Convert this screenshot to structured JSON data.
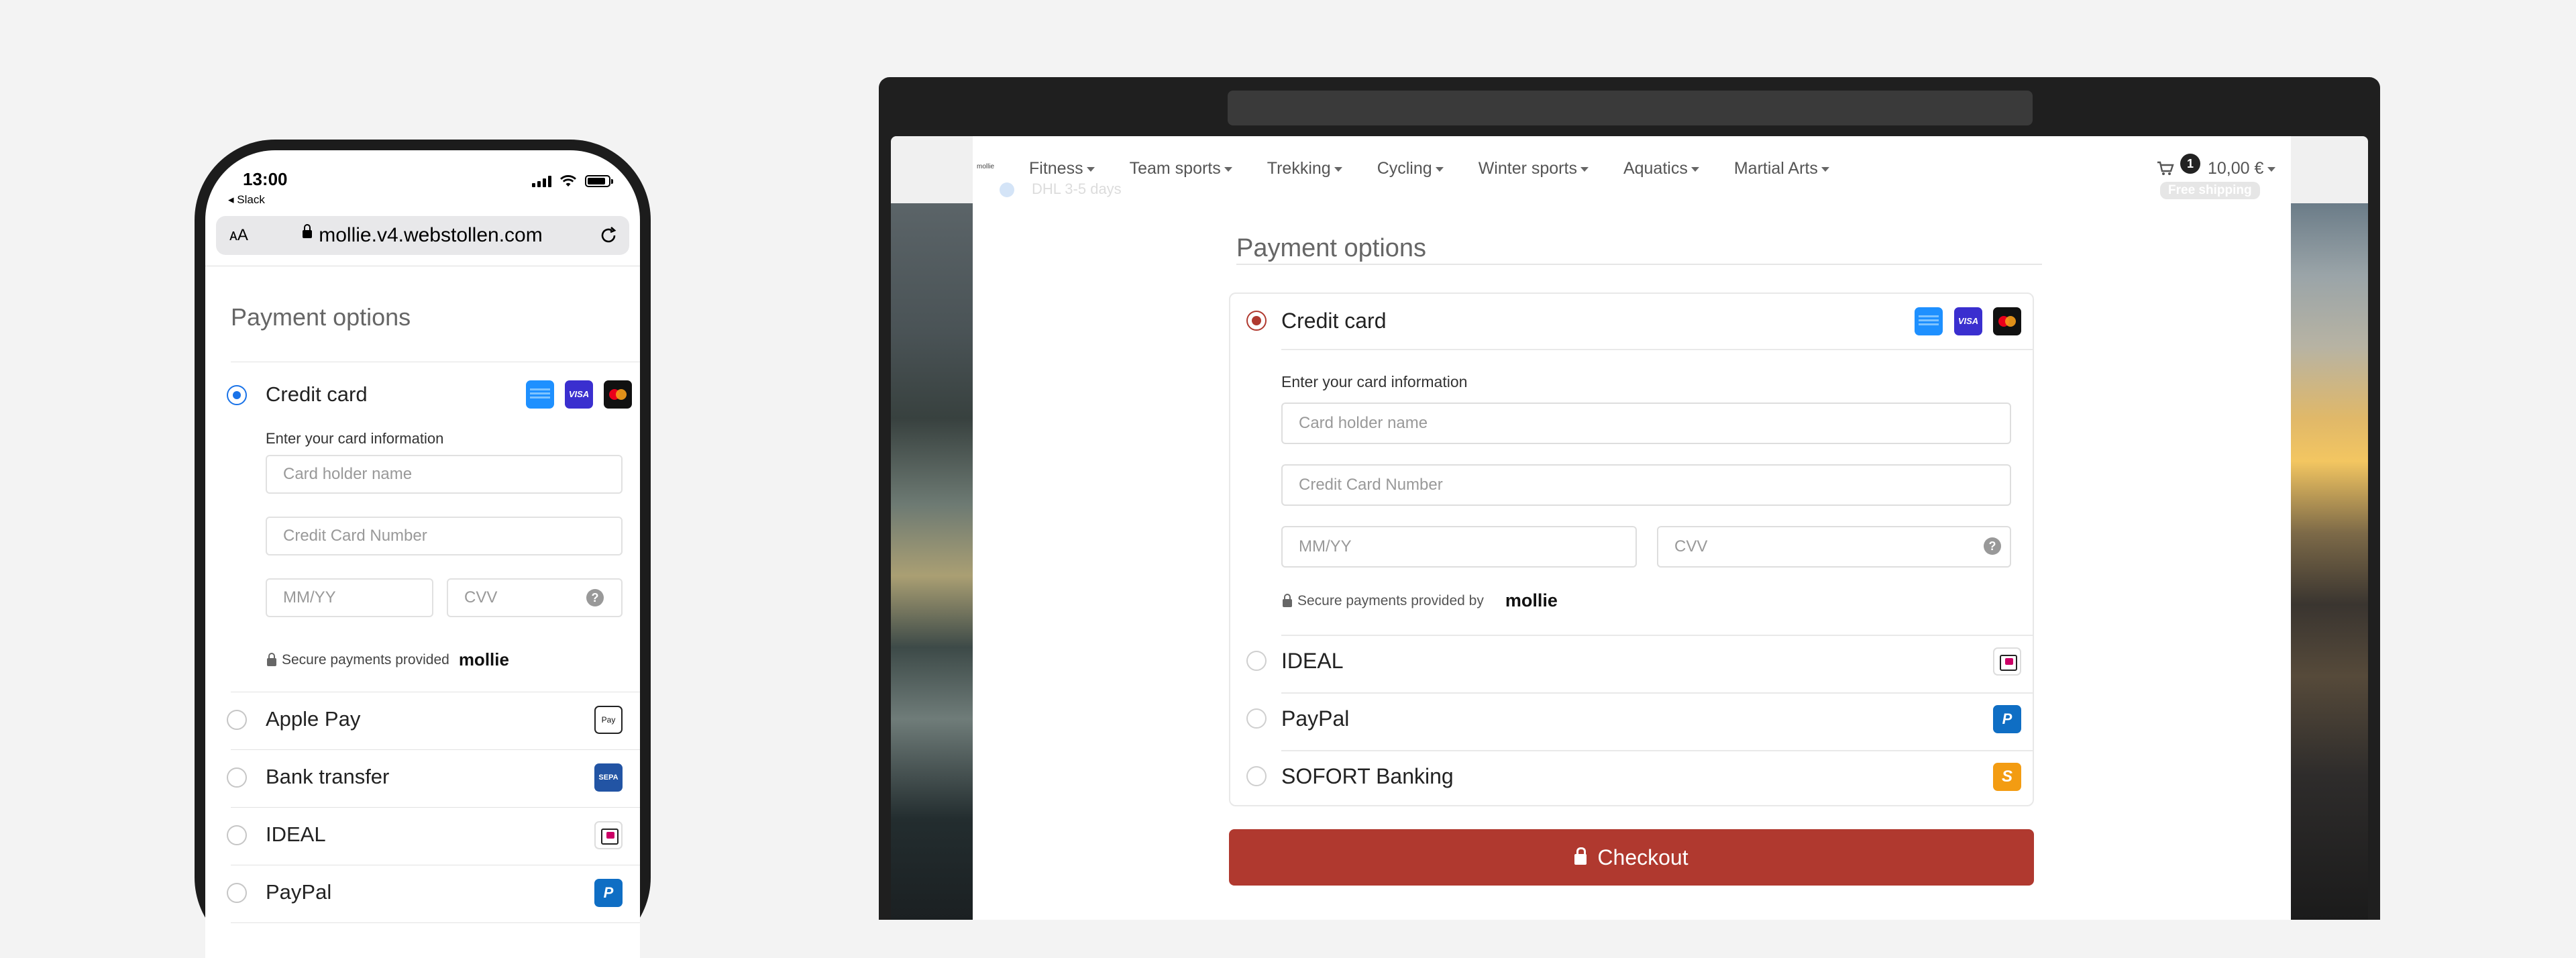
{
  "phone": {
    "status": {
      "time": "13:00",
      "back_app": "◂ Slack"
    },
    "browser": {
      "text_size_label": "ᴀA",
      "url": "mollie.v4.webstollen.com"
    },
    "payment_title": "Payment options",
    "credit_card": {
      "label": "Credit card",
      "selected": true,
      "card_info_label": "Enter your card information",
      "holder_placeholder": "Card holder name",
      "number_placeholder": "Credit Card Number",
      "expiry_placeholder": "MM/YY",
      "cvv_placeholder": "CVV",
      "help": "?",
      "secure_text": "Secure payments provided",
      "provider": "mollie",
      "icons": [
        "amex-icon",
        "visa-icon",
        "mastercard-icon"
      ],
      "visa_text": "VISA"
    },
    "methods": [
      {
        "label": "Apple Pay",
        "icon": "apple-pay-icon",
        "icon_text": "Pay"
      },
      {
        "label": "Bank transfer",
        "icon": "sepa-icon",
        "icon_text": "SEPA"
      },
      {
        "label": "IDEAL",
        "icon": "ideal-icon",
        "icon_text": ""
      },
      {
        "label": "PayPal",
        "icon": "paypal-icon",
        "icon_text": "P"
      }
    ],
    "radio_color": "#1a73e8"
  },
  "desktop": {
    "logo_text": "mollie",
    "nav": [
      "Fitness",
      "Team sports",
      "Trekking",
      "Cycling",
      "Winter sports",
      "Aquatics",
      "Martial Arts"
    ],
    "cart": {
      "count": "1",
      "total": "10,00 €",
      "badge": "Free shipping"
    },
    "shipping_hint": "DHL 3-5 days",
    "payment_title": "Payment options",
    "credit_card": {
      "label": "Credit card",
      "selected": true,
      "card_info_label": "Enter your card information",
      "holder_placeholder": "Card holder name",
      "number_placeholder": "Credit Card Number",
      "expiry_placeholder": "MM/YY",
      "cvv_placeholder": "CVV",
      "help": "?",
      "secure_text": "Secure payments provided by",
      "provider": "mollie",
      "visa_text": "VISA"
    },
    "methods": [
      {
        "label": "IDEAL",
        "icon": "ideal-icon",
        "icon_text": ""
      },
      {
        "label": "PayPal",
        "icon": "paypal-icon",
        "icon_text": "P"
      },
      {
        "label": "SOFORT Banking",
        "icon": "sofort-icon",
        "icon_text": "S"
      }
    ],
    "checkout_label": "Checkout",
    "accent_color": "#b0392f"
  }
}
